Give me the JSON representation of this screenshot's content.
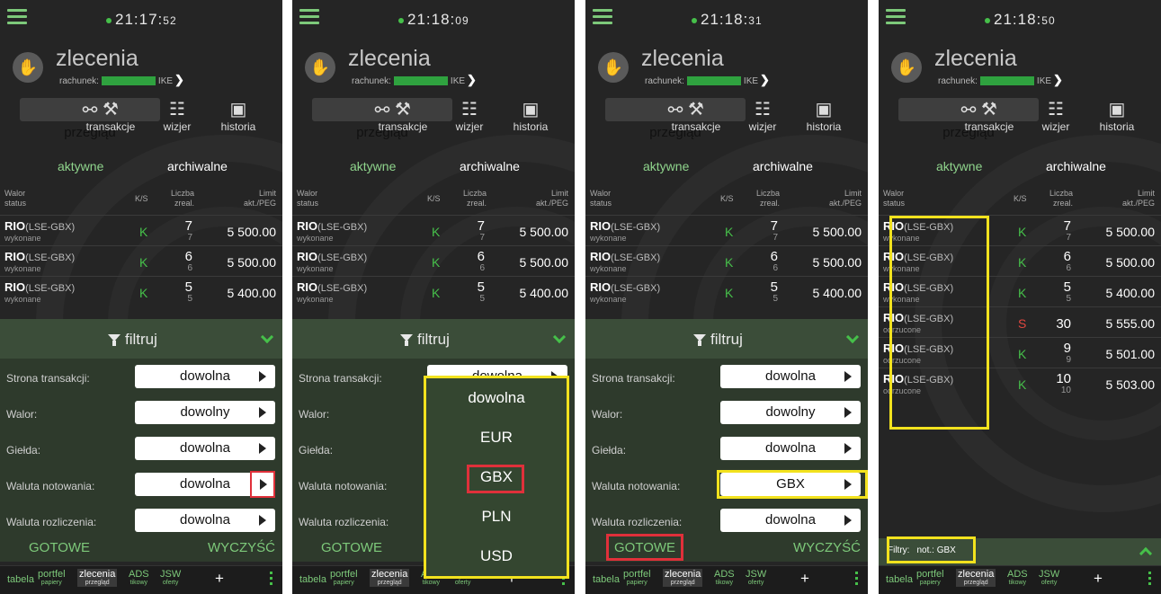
{
  "app": {
    "title": "zlecenia",
    "account_label": "rachunek:",
    "account_suffix": "IKE"
  },
  "clocks": [
    {
      "hm": "21:17:",
      "s": "52"
    },
    {
      "hm": "21:18:",
      "s": "09"
    },
    {
      "hm": "21:18:",
      "s": "31"
    },
    {
      "hm": "21:18:",
      "s": "50"
    }
  ],
  "tabs": [
    "przegląd",
    "transakcje",
    "wizjer",
    "historia"
  ],
  "segments": {
    "active": "aktywne",
    "archived": "archiwalne"
  },
  "columns": {
    "walor": "Walor",
    "status": "status",
    "ks": "K/S",
    "liczba": "Liczba",
    "zreal": "zreal.",
    "limit": "Limit",
    "akt": "akt./PEG"
  },
  "rows_base": [
    {
      "name": "RIO",
      "exchange": "(LSE-GBX)",
      "status": "wykonane",
      "side": "K",
      "qty": "7",
      "qty_done": "7",
      "limit": "5 500.00"
    },
    {
      "name": "RIO",
      "exchange": "(LSE-GBX)",
      "status": "wykonane",
      "side": "K",
      "qty": "6",
      "qty_done": "6",
      "limit": "5 500.00"
    },
    {
      "name": "RIO",
      "exchange": "(LSE-GBX)",
      "status": "wykonane",
      "side": "K",
      "qty": "5",
      "qty_done": "5",
      "limit": "5 400.00"
    }
  ],
  "rows_extra": [
    {
      "name": "RIO",
      "exchange": "(LSE-GBX)",
      "status": "odrzucone",
      "side": "S",
      "qty": "30",
      "qty_done": "",
      "limit": "5 555.00"
    },
    {
      "name": "RIO",
      "exchange": "(LSE-GBX)",
      "status": "odrzucone",
      "side": "K",
      "qty": "9",
      "qty_done": "9",
      "limit": "5 501.00"
    },
    {
      "name": "RIO",
      "exchange": "(LSE-GBX)",
      "status": "odrzucone",
      "side": "K",
      "qty": "10",
      "qty_done": "10",
      "limit": "5 503.00"
    }
  ],
  "filter": {
    "title": "filtruj",
    "labels": [
      "Strona transakcji:",
      "Walor:",
      "Giełda:",
      "Waluta notowania:",
      "Waluta rozliczenia:"
    ],
    "values_a": [
      "dowolna",
      "dowolny",
      "dowolna",
      "dowolna",
      "dowolna"
    ],
    "values_c": [
      "dowolna",
      "dowolny",
      "dowolna",
      "GBX",
      "dowolna"
    ],
    "done": "GOTOWE",
    "clear": "WYCZYŚĆ"
  },
  "dropdown": [
    "dowolna",
    "EUR",
    "GBX",
    "PLN",
    "USD"
  ],
  "filter_bar": {
    "label": "Filtry:",
    "value": "not.: GBX"
  },
  "bottom_nav": [
    {
      "label": "tabela",
      "sub": ""
    },
    {
      "label": "portfel",
      "sub": "papiery"
    },
    {
      "label": "zlecenia",
      "sub": "przegląd"
    },
    {
      "label": "ADS",
      "sub": "tikowy"
    },
    {
      "label": "JSW",
      "sub": "oferty"
    }
  ],
  "bottom_plus": "+",
  "icons": {
    "menu": "hamburger-icon",
    "hand": "handshake-icon",
    "funnel": "filter-icon"
  },
  "colors": {
    "accent": "#46c04a",
    "highlight_yellow": "#f2e21e",
    "highlight_red": "#e0303a",
    "buy": "#46c04a",
    "sell": "#e0473f"
  }
}
